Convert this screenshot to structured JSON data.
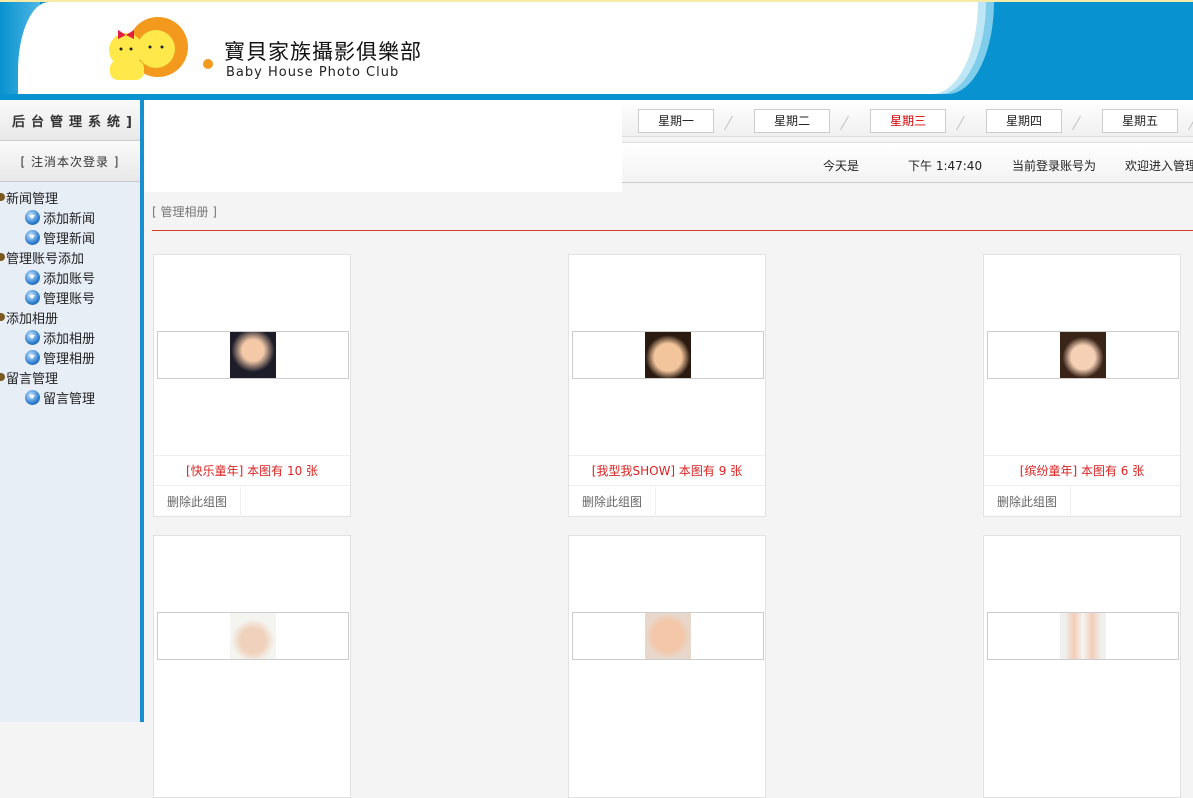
{
  "header": {
    "title_cn": "寶貝家族攝影俱樂部",
    "title_en": "Baby House Photo Club"
  },
  "sidebar": {
    "system_title": "后台管理系统]",
    "logout": "[ 注消本次登录 ]",
    "groups": [
      {
        "label": "新闻管理",
        "items": [
          "添加新闻",
          "管理新闻"
        ]
      },
      {
        "label": "管理账号添加",
        "items": [
          "添加账号",
          "管理账号"
        ]
      },
      {
        "label": "添加相册",
        "items": [
          "添加相册",
          "管理相册"
        ]
      },
      {
        "label": "留言管理",
        "items": [
          "留言管理"
        ]
      }
    ]
  },
  "tabs": [
    {
      "label": "星期一"
    },
    {
      "label": "星期二"
    },
    {
      "label": "星期三",
      "active": true
    },
    {
      "label": "星期四"
    },
    {
      "label": "星期五"
    }
  ],
  "info": {
    "today": "今天是",
    "time": "下午 1:47:40",
    "account": "当前登录账号为",
    "welcome": "欢迎进入管理"
  },
  "breadcrumb": "[ 管理相册 ]",
  "colors": {
    "accent": "#0892d0",
    "caption": "#dd2222",
    "rule": "#d04020"
  },
  "albums": [
    {
      "caption": "[快乐童年] 本图有 10 张",
      "delete": "删除此组图"
    },
    {
      "caption": "[我型我SHOW] 本图有 9 张",
      "delete": "删除此组图"
    },
    {
      "caption": "[缤纷童年] 本图有 6 张",
      "delete": "删除此组图"
    },
    {},
    {},
    {}
  ]
}
